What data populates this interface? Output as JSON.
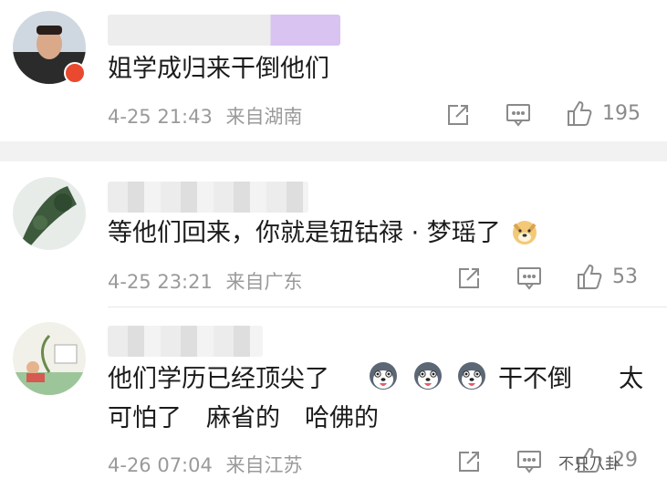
{
  "comments": [
    {
      "text": "姐学成归来干倒他们",
      "date": "4-25 21:43",
      "location": "来自湖南",
      "likes": "195"
    },
    {
      "text_prefix": "等他们回来，你就是钮钴禄 · 梦瑶了",
      "date": "4-25 23:21",
      "location": "来自广东",
      "likes": "53"
    },
    {
      "line1_a": "他们学历已经顶尖了",
      "line1_b": "干不倒",
      "line1_c": "太",
      "line2": "可怕了　麻省的　哈佛的",
      "date": "4-26 07:04",
      "location": "来自江苏",
      "likes": "29"
    }
  ],
  "watermark": "不只八卦",
  "icons": [
    "share-icon",
    "comment-icon",
    "like-icon",
    "doge-emoji",
    "husky-emoji"
  ],
  "colors": {
    "meta_text": "#9a9a9a",
    "badge": "#e8492f",
    "divider": "#f2f2f2"
  }
}
